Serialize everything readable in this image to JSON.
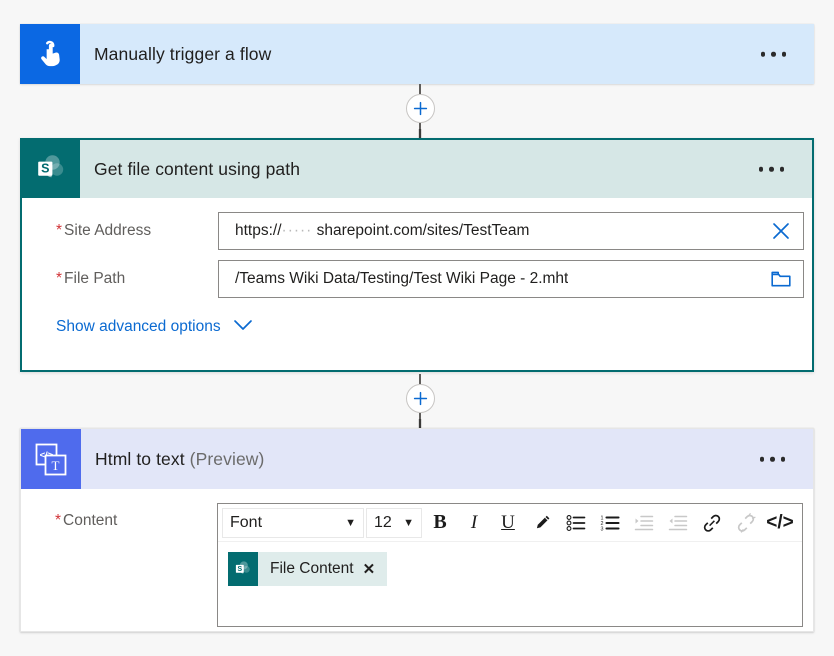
{
  "flow": {
    "trigger": {
      "title": "Manually trigger a flow",
      "icon": "tap-hand-icon",
      "menu_label": "…",
      "accent": "#0b68e3",
      "header_bg": "#d6e9fb"
    },
    "sharepoint_action": {
      "title": "Get file content using path",
      "icon": "sharepoint-icon",
      "menu_label": "…",
      "accent": "#036c70",
      "header_bg": "#d6e7e6",
      "fields": [
        {
          "label": "Site Address",
          "required": true,
          "value_prefix": "https://",
          "value_redacted": "·····",
          "value_suffix": "sharepoint.com/sites/TestTeam",
          "action_icon": "clear-x-icon"
        },
        {
          "label": "File Path",
          "required": true,
          "value": "/Teams Wiki Data/Testing/Test Wiki Page - 2.mht",
          "action_icon": "folder-picker-icon"
        }
      ],
      "advanced_options": {
        "label": "Show advanced options",
        "icon": "chevron-down-icon",
        "color": "#0b6ad1"
      }
    },
    "html_to_text_action": {
      "title": "Html to text",
      "title_suffix": "(Preview)",
      "icon": "html-to-text-icon",
      "menu_label": "…",
      "accent": "#4f6bed",
      "header_bg": "#e2e6f8",
      "content_field": {
        "label": "Content",
        "required": true,
        "toolbar": {
          "font_name": "Font",
          "font_size": "12",
          "buttons": [
            {
              "name": "bold",
              "glyph": "B",
              "disabled": false
            },
            {
              "name": "italic",
              "glyph": "I",
              "disabled": false
            },
            {
              "name": "underline",
              "glyph": "U",
              "disabled": false
            },
            {
              "name": "text-color",
              "glyph": "pen",
              "disabled": false
            },
            {
              "name": "bulleted-list",
              "glyph": "ul",
              "disabled": false
            },
            {
              "name": "numbered-list",
              "glyph": "ol",
              "disabled": false
            },
            {
              "name": "indent",
              "glyph": "indent",
              "disabled": true
            },
            {
              "name": "outdent",
              "glyph": "outdent",
              "disabled": true
            },
            {
              "name": "insert-link",
              "glyph": "link",
              "disabled": false
            },
            {
              "name": "remove-link",
              "glyph": "unlink",
              "disabled": true
            },
            {
              "name": "code-view",
              "glyph": "</>",
              "disabled": false
            }
          ]
        },
        "tokens": [
          {
            "label": "File Content",
            "icon": "sharepoint-icon",
            "remove": "✕"
          }
        ]
      }
    },
    "connectors": [
      {
        "plus_label": "+"
      },
      {
        "plus_label": "+"
      }
    ]
  }
}
